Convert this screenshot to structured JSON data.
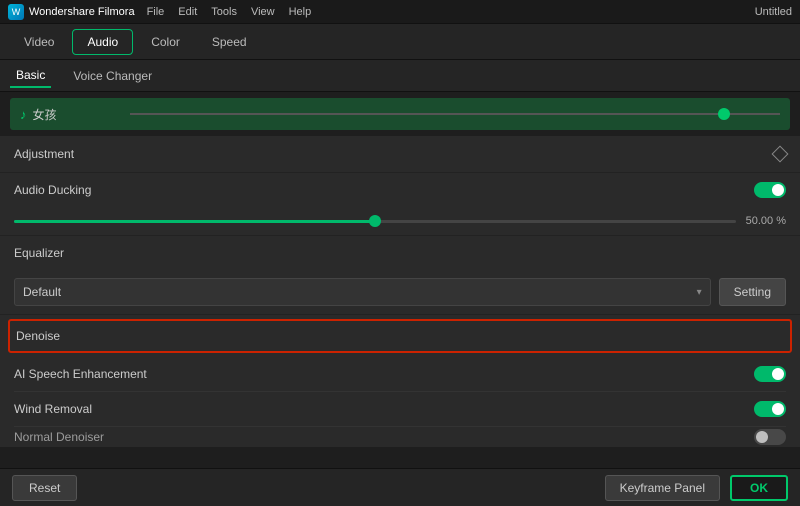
{
  "titlebar": {
    "app_name": "Wondershare Filmora",
    "menu_items": [
      "File",
      "Edit",
      "Tools",
      "View",
      "Help"
    ],
    "window_title": "Untitled"
  },
  "main_tabs": [
    {
      "label": "Video",
      "active": false
    },
    {
      "label": "Audio",
      "active": true
    },
    {
      "label": "Color",
      "active": false
    },
    {
      "label": "Speed",
      "active": false
    }
  ],
  "sub_tabs": [
    {
      "label": "Basic",
      "active": true
    },
    {
      "label": "Voice Changer",
      "active": false
    }
  ],
  "audio_track": {
    "icon": "♪",
    "name": "女孩"
  },
  "adjustment_section": {
    "title": "Adjustment"
  },
  "audio_ducking": {
    "label": "Audio Ducking",
    "enabled": true,
    "value": "50.00",
    "unit": "%"
  },
  "equalizer": {
    "label": "Equalizer",
    "value": "Default",
    "setting_btn": "Setting"
  },
  "denoise": {
    "title": "Denoise"
  },
  "ai_speech_enhancement": {
    "label": "AI Speech Enhancement",
    "enabled": true
  },
  "wind_removal": {
    "label": "Wind Removal",
    "enabled": true
  },
  "normal_denoiser": {
    "label": "Normal Denoiser"
  },
  "bottom_bar": {
    "reset_label": "Reset",
    "keyframe_panel_label": "Keyframe Panel",
    "ok_label": "OK"
  }
}
